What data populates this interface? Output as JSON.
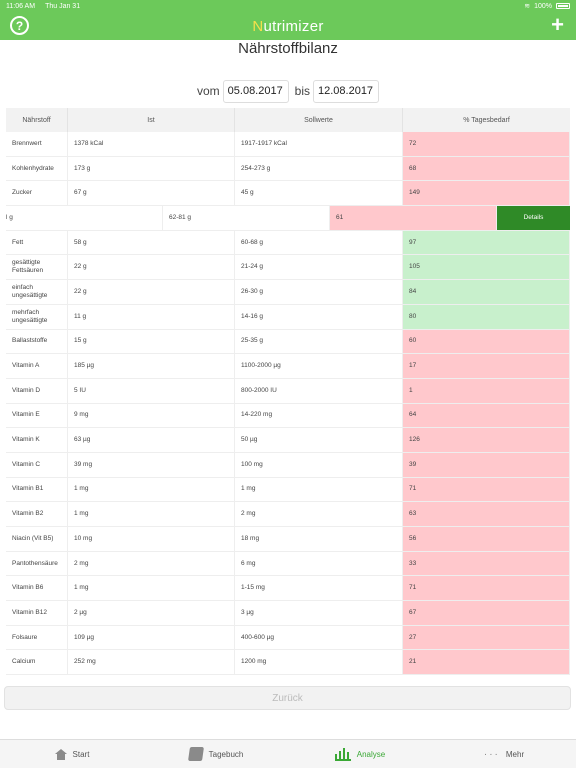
{
  "status": {
    "time": "11:06 AM",
    "date": "Thu Jan 31",
    "battery": "100%"
  },
  "navbar": {
    "title_first": "N",
    "title_rest": "utrimizer",
    "help_label": "?",
    "add_label": "+"
  },
  "page": {
    "title": "Nährstoffbilanz"
  },
  "dates": {
    "from_label": "vom",
    "from_value": "05.08.2017",
    "to_label": "bis",
    "to_value": "12.08.2017"
  },
  "table": {
    "headers": [
      "Nährstoff",
      "Ist",
      "Sollwerte",
      "% Tagesbedarf"
    ],
    "rows_top": [
      {
        "name": "Brennwert",
        "ist": "1378 kCal",
        "soll": "1917-1917 kCal",
        "pct": "72",
        "status": "red"
      },
      {
        "name": "Kohlenhydrate",
        "ist": "173 g",
        "soll": "254-273 g",
        "pct": "68",
        "status": "red"
      },
      {
        "name": "Zucker",
        "ist": "67 g",
        "soll": "45 g",
        "pct": "149",
        "status": "red"
      }
    ],
    "swiped_row": {
      "ist": "l g",
      "soll": "62-81 g",
      "pct": "61",
      "action": "Details"
    },
    "rows_bottom": [
      {
        "name": "Fett",
        "ist": "58 g",
        "soll": "60-68 g",
        "pct": "97",
        "status": "green"
      },
      {
        "name": "gesättigte Fettsäuren",
        "ist": "22 g",
        "soll": "21-24 g",
        "pct": "105",
        "status": "green"
      },
      {
        "name": "einfach ungesättigte",
        "ist": "22 g",
        "soll": "26-30 g",
        "pct": "84",
        "status": "green"
      },
      {
        "name": "mehrfach ungesättigte",
        "ist": "11 g",
        "soll": "14-16 g",
        "pct": "80",
        "status": "green"
      },
      {
        "name": "Ballaststoffe",
        "ist": "15 g",
        "soll": "25-35 g",
        "pct": "60",
        "status": "red"
      },
      {
        "name": "Vitamin A",
        "ist": "185 µg",
        "soll": "1100-2000 µg",
        "pct": "17",
        "status": "red"
      },
      {
        "name": "Vitamin D",
        "ist": "5 IU",
        "soll": "800-2000 IU",
        "pct": "1",
        "status": "red"
      },
      {
        "name": "Vitamin E",
        "ist": "9 mg",
        "soll": "14-220 mg",
        "pct": "64",
        "status": "red"
      },
      {
        "name": "Vitamin K",
        "ist": "63 µg",
        "soll": "50 µg",
        "pct": "126",
        "status": "red"
      },
      {
        "name": "Vitamin C",
        "ist": "39 mg",
        "soll": "100 mg",
        "pct": "39",
        "status": "red"
      },
      {
        "name": "Vitamin B1",
        "ist": "1 mg",
        "soll": "1 mg",
        "pct": "71",
        "status": "red"
      },
      {
        "name": "Vitamin B2",
        "ist": "1 mg",
        "soll": "2 mg",
        "pct": "63",
        "status": "red"
      },
      {
        "name": "Niacin (Vit B5)",
        "ist": "10 mg",
        "soll": "18 mg",
        "pct": "56",
        "status": "red"
      },
      {
        "name": "Pantothensäure",
        "ist": "2 mg",
        "soll": "6 mg",
        "pct": "33",
        "status": "red"
      },
      {
        "name": "Vitamin B6",
        "ist": "1 mg",
        "soll": "1-15 mg",
        "pct": "71",
        "status": "red"
      },
      {
        "name": "Vitamin B12",
        "ist": "2 µg",
        "soll": "3 µg",
        "pct": "67",
        "status": "red"
      },
      {
        "name": "Folsaure",
        "ist": "109 µg",
        "soll": "400-600 µg",
        "pct": "27",
        "status": "red"
      },
      {
        "name": "Calcium",
        "ist": "252 mg",
        "soll": "1200 mg",
        "pct": "21",
        "status": "red"
      }
    ]
  },
  "back_button": {
    "label": "Zurück"
  },
  "tabbar": {
    "tabs": [
      {
        "label": "Start",
        "icon": "home-icon"
      },
      {
        "label": "Tagebuch",
        "icon": "book-icon"
      },
      {
        "label": "Analyse",
        "icon": "chart-icon"
      },
      {
        "label": "Mehr",
        "icon": "more-icon"
      }
    ]
  },
  "colors": {
    "brand": "#6cc95a",
    "red_cell": "#ffc8cc",
    "green_cell": "#c8f0cc",
    "details_button": "#2f8a27"
  }
}
